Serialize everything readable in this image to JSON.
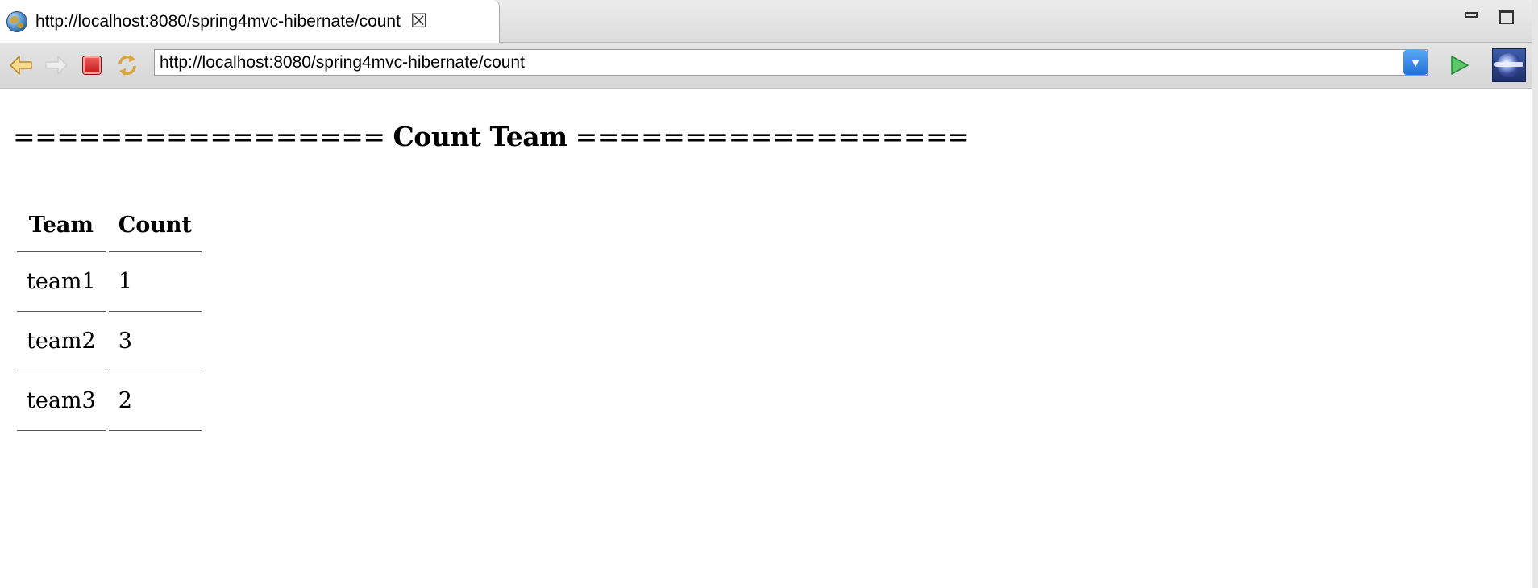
{
  "tab": {
    "title": "http://localhost:8080/spring4mvc-hibernate/count",
    "icon": "globe-icon",
    "close_icon": "close-icon"
  },
  "window": {
    "minimize_icon": "minimize-icon",
    "maximize_icon": "maximize-icon"
  },
  "toolbar": {
    "back_icon": "back-arrow-icon",
    "forward_icon": "forward-arrow-icon",
    "stop_icon": "stop-icon",
    "refresh_icon": "refresh-icon",
    "url": "http://localhost:8080/spring4mvc-hibernate/count",
    "dropdown_icon": "chevron-down-icon",
    "go_icon": "go-arrow-icon",
    "eclipse_icon": "eclipse-icon"
  },
  "page": {
    "heading_prefix": "================= ",
    "heading_title": "Count Team",
    "heading_suffix": " ==================",
    "table": {
      "headers": [
        "Team",
        "Count"
      ],
      "rows": [
        [
          "team1",
          "1"
        ],
        [
          "team2",
          "3"
        ],
        [
          "team3",
          "2"
        ]
      ]
    }
  },
  "colors": {
    "stop_red": "#d42020",
    "back_arrow": "#e8b84a",
    "go_green": "#2fa84a",
    "dropdown_blue": "#2b82e8"
  }
}
